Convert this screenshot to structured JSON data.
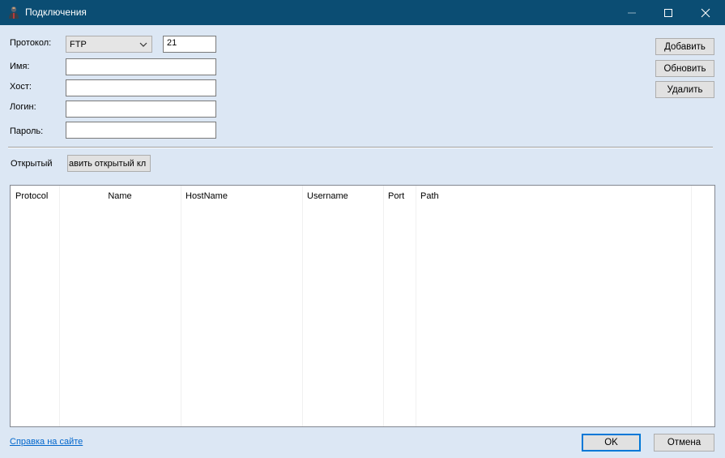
{
  "window": {
    "title": "Подключения",
    "icons": {
      "app": "app-icon",
      "minimize": "minimize-icon",
      "maximize": "maximize-icon",
      "close": "close-icon"
    }
  },
  "form": {
    "protocol_label": "Протокол:",
    "protocol_value": "FTP",
    "port_value": "21",
    "name_label": "Имя:",
    "name_value": "",
    "host_label": "Хост:",
    "host_value": "",
    "login_label": "Логин:",
    "login_value": "",
    "password_label": "Пароль:",
    "password_value": ""
  },
  "side_buttons": {
    "add": "Добавить",
    "update": "Обновить",
    "delete": "Удалить"
  },
  "key": {
    "label": "Открытый",
    "button": "авить открытый кл"
  },
  "table": {
    "columns": [
      "Protocol",
      "Name",
      "HostName",
      "Username",
      "Port",
      "Path"
    ],
    "rows": []
  },
  "footer": {
    "help_link": "Справка на сайте",
    "ok": "OK",
    "cancel": "Отмена"
  },
  "colors": {
    "titlebar": "#0b4d73",
    "background": "#dce7f4",
    "link": "#0066cc",
    "focus": "#0078d7"
  }
}
